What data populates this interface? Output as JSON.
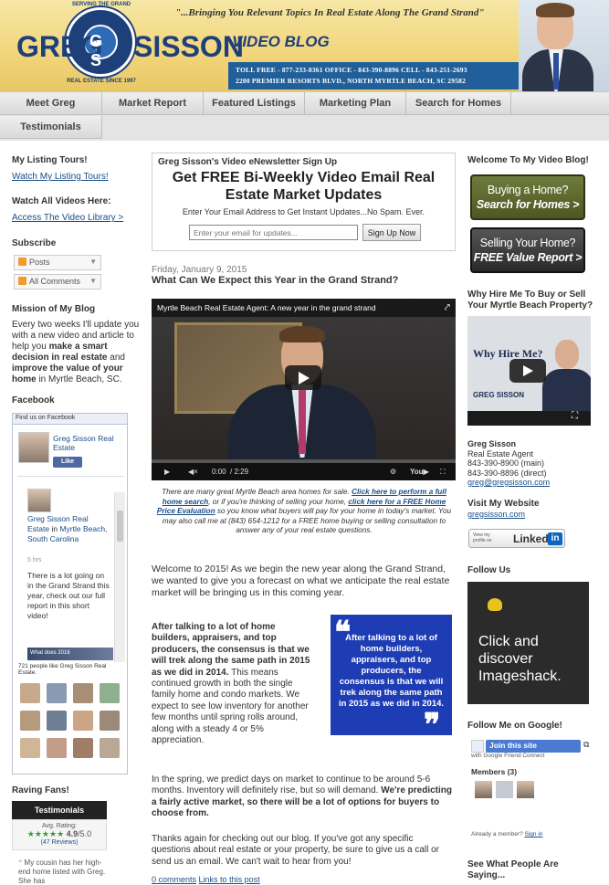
{
  "header": {
    "logo_text": "GREG",
    "logo_text_right": "SISSON",
    "badge_top": "SERVING THE GRAND STRAND",
    "badge_bottom": "REAL ESTATE SINCE 1997",
    "badge_center": "G S",
    "tagline": "\"...Bringing You Relevant Topics In Real Estate Along The Grand Strand\"",
    "video_blog": "VIDEO BLOG",
    "contact_line1": "TOLL FREE - 877-233-8361  OFFICE - 843-390-8896  CELL - 843-251-2693",
    "contact_line2": "2200 PREMIER RESORTS BLVD., NORTH MYRTLE BEACH, SC 29582"
  },
  "nav": {
    "items": [
      "Meet Greg",
      "Market Report",
      "Featured Listings",
      "Marketing Plan",
      "Search for Homes",
      "Testimonials"
    ]
  },
  "left": {
    "tours_title": "My Listing Tours!",
    "tours_link": "Watch My Listing Tours!",
    "videos_title": "Watch All Videos Here:",
    "videos_link": "Access The Video Library >",
    "subscribe_title": "Subscribe",
    "subscribe_posts": "Posts",
    "subscribe_comments": "All Comments",
    "mission_title": "Mission of My Blog",
    "mission_text_1": "Every two weeks I'll update you with a new video and article to help you ",
    "mission_bold_1": "make a smart decision in real estate",
    "mission_text_2": " and ",
    "mission_bold_2": "improve the value of your home",
    "mission_text_3": " in Myrtle Beach, SC.",
    "facebook_title": "Facebook",
    "fb_header": "Find us on Facebook",
    "fb_page_name": "Greg Sisson Real Estate",
    "fb_like": "Like",
    "fb_post_author": "Greg Sisson Real Estate",
    "fb_post_in": " in ",
    "fb_post_location": "Myrtle Beach, South Carolina",
    "fb_post_time": "5 hrs",
    "fb_post_text": "There is a lot going on in the Grand Strand this year, check out our full report in this short video!",
    "fb_video_label": "What does 2016",
    "fb_likes": "721 people like Greg Sisson Real Estate.",
    "raving_title": "Raving Fans!",
    "testimonials_label": "Testimonials",
    "avg_rating_label": "Avg. Rating:",
    "rating_value": "4.9",
    "rating_max": "/5.0",
    "reviews": "(47 Reviews)",
    "review_snippet": "My cousin has her high-end home listed with Greg. She has"
  },
  "signup": {
    "kicker": "Greg Sisson's Video eNewsletter Sign Up",
    "headline": "Get FREE Bi-Weekly Video Email Real Estate Market Updates",
    "sub": "Enter Your Email Address to Get Instant Updates...No Spam. Ever.",
    "placeholder": "Enter your email for updates...",
    "button": "Sign Up Now"
  },
  "post": {
    "date": "Friday, January 9, 2015",
    "title": "What Can We Expect this Year in the Grand Strand?",
    "video_title": "Myrtle Beach Real Estate Agent: A new year in the grand strand",
    "video_time": "0:00",
    "video_duration": "/ 2:29",
    "caption_1": "There are many great Myrtle Beach area homes for sale. ",
    "caption_link1": "Click here to perform a full home search",
    "caption_2": ", or if you're thinking of selling your home, ",
    "caption_link2": "click here for a FREE Home Price Evaluation",
    "caption_3": " so you know what buyers will pay for your home in today's market. You may also call me at (843) 654-1212 for a FREE home buying or selling consultation to answer any of your real estate questions.",
    "intro": "Welcome to 2015! As we begin the new year along the Grand Strand, we wanted to give you a forecast on what we anticipate the real estate market will be bringing us in this coming year.",
    "bold_lead": "After talking to a lot of home builders, appraisers, and top producers, the consensus is that we will trek along the same path in 2015 as we did in 2014.",
    "para2_rest": " This means continued growth in both the single family home and condo markets. We expect to see low inventory for another few months until spring rolls around, along with a steady 4 or 5% appreciation.",
    "quote": "After talking to a lot of home builders, appraisers, and top producers, the consensus is that we will trek along the same path in 2015 as we did in 2014.",
    "para3_a": "In the spring, we predict days on market to continue to be around 5-6 months. Inventory will definitely rise, but so will demand. ",
    "para3_bold": "We're predicting a fairly active market, so there will be a lot of options for buyers to choose from.",
    "para4": "Thanks again for checking out our blog. If you've got any specific questions about real estate or your property, be sure to give us a call or send us an email. We can't wait to hear from you!",
    "comments_link": "0 comments",
    "permalink": "Links to this post"
  },
  "right": {
    "welcome_title": "Welcome To My Video Blog!",
    "buy_btn_line1": "Buying a Home?",
    "buy_btn_line2": "Search for Homes >",
    "sell_btn_line1": "Selling Your Home?",
    "sell_btn_line2": "FREE Value Report >",
    "why_title": "Why Hire Me To Buy or Sell Your Myrtle Beach Property?",
    "why_video_text": "Why Hire Me?",
    "why_logo": "GREG SISSON",
    "name": "Greg Sisson",
    "role": "Real Estate Agent",
    "phone_main": "843-390-8900 (main)",
    "phone_direct": "843-390-8896 (direct)",
    "email": "greg@gregsisson.com",
    "website_title": "Visit My Website",
    "website": "gregsisson.com",
    "linkedin_small": "View my profile on",
    "linkedin_brand": "Linked",
    "linkedin_in": "in",
    "follow_title": "Follow Us",
    "imageshack_text": "Click and discover Imageshack.",
    "google_title": "Follow Me on Google!",
    "join_btn": "Join this site",
    "gfc_caption": "with Google Friend Connect",
    "members": "Members (3)",
    "already_member": "Already a member? ",
    "sign_in": "Sign in",
    "see_people": "See What People Are Saying..."
  },
  "colors": {
    "brand_blue": "#1d3f7a",
    "contact_bar": "#215f9a",
    "quote_blue": "#1e3db5",
    "cta_green": "#5c6a2c"
  }
}
